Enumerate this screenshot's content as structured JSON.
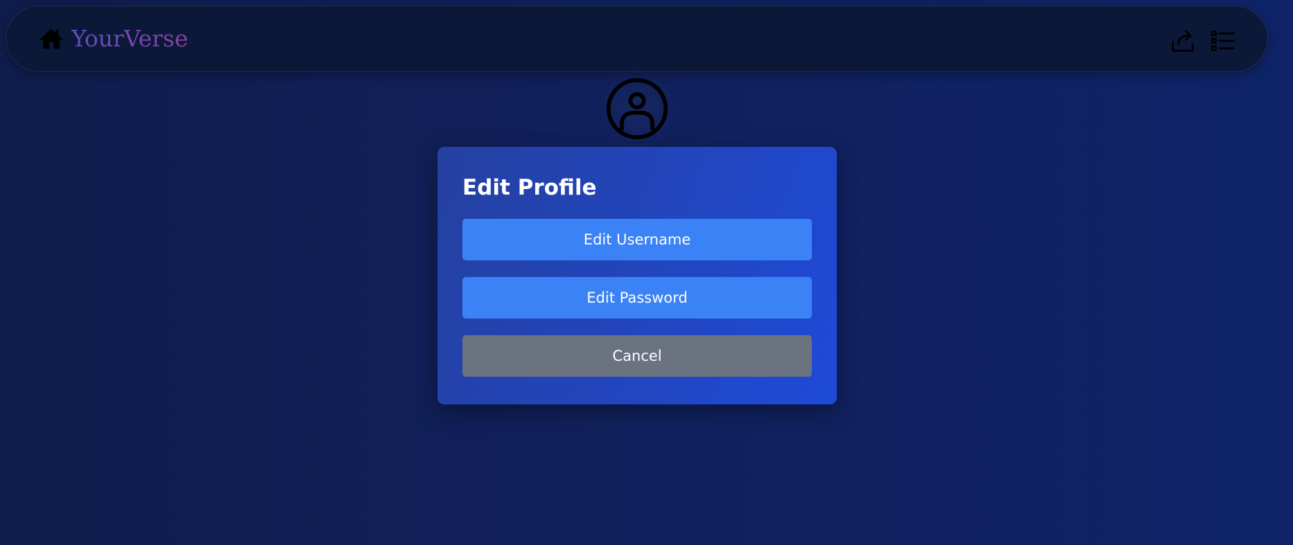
{
  "navbar": {
    "brand_name": "YourVerse",
    "icons": {
      "home": "home-icon",
      "share": "share-icon",
      "menu": "list-menu-icon"
    }
  },
  "profile": {
    "avatar_icon": "user-circle-icon"
  },
  "modal": {
    "title": "Edit Profile",
    "edit_username_label": "Edit Username",
    "edit_password_label": "Edit Password",
    "cancel_label": "Cancel"
  },
  "colors": {
    "background": "#0f1d4d",
    "navbar": "#0b1838",
    "modal": "#1f4ad8",
    "primary_button": "#3b82f6",
    "cancel_button": "#6b7280",
    "brand_gradient_start": "#5b4fc4",
    "brand_gradient_end": "#8a3fa0"
  }
}
